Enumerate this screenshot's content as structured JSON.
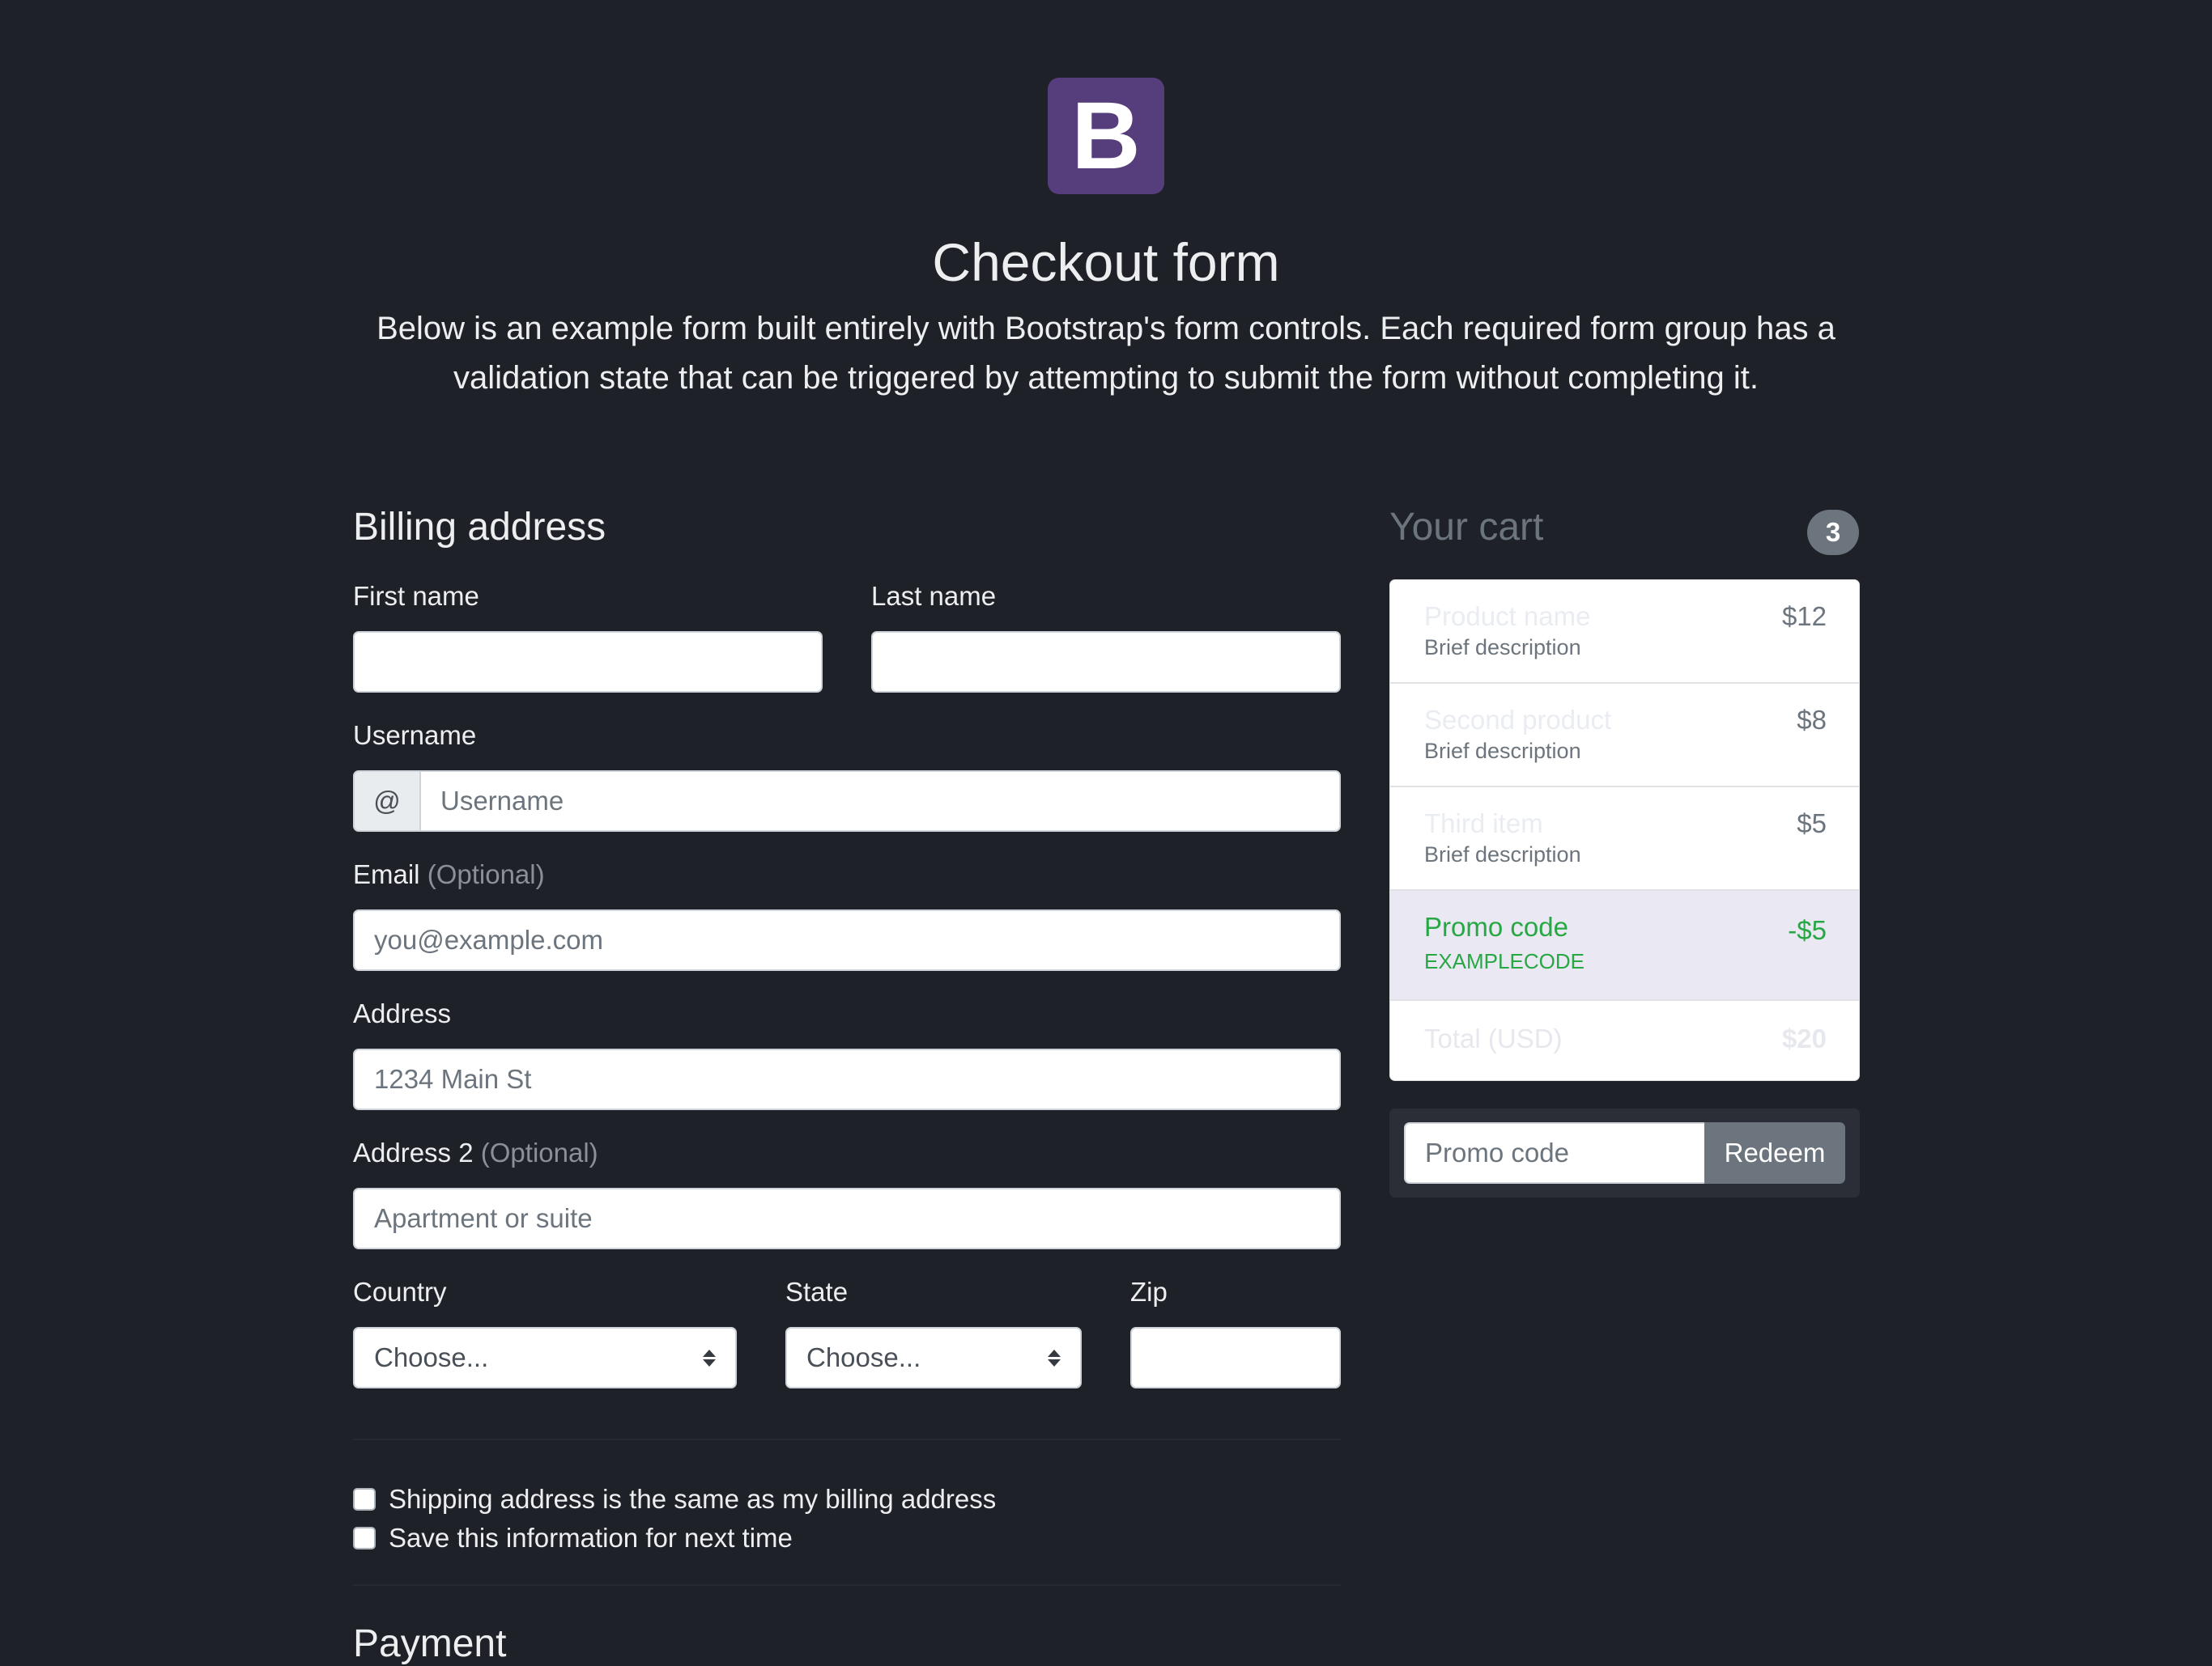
{
  "header": {
    "logo_letter": "B",
    "title": "Checkout form",
    "lead": "Below is an example form built entirely with Bootstrap's form controls. Each required form group has a validation state that can be triggered by attempting to submit the form without completing it."
  },
  "billing": {
    "heading": "Billing address",
    "first_name_label": "First name",
    "first_name_value": "",
    "last_name_label": "Last name",
    "last_name_value": "",
    "username_label": "Username",
    "username_prefix": "@",
    "username_placeholder": "Username",
    "email_label": "Email",
    "email_optional": "(Optional)",
    "email_placeholder": "you@example.com",
    "address_label": "Address",
    "address_placeholder": "1234 Main St",
    "address2_label": "Address 2",
    "address2_optional": "(Optional)",
    "address2_placeholder": "Apartment or suite",
    "country_label": "Country",
    "country_selected": "Choose...",
    "state_label": "State",
    "state_selected": "Choose...",
    "zip_label": "Zip",
    "zip_value": "",
    "same_address_label": "Shipping address is the same as my billing address",
    "save_info_label": "Save this information for next time"
  },
  "payment": {
    "heading": "Payment"
  },
  "cart": {
    "title": "Your cart",
    "count": "3",
    "items": [
      {
        "name": "Product name",
        "description": "Brief description",
        "price": "$12"
      },
      {
        "name": "Second product",
        "description": "Brief description",
        "price": "$8"
      },
      {
        "name": "Third item",
        "description": "Brief description",
        "price": "$5"
      }
    ],
    "promo": {
      "name": "Promo code",
      "code": "EXAMPLECODE",
      "amount": "-$5"
    },
    "total": {
      "label": "Total (USD)",
      "amount": "$20"
    },
    "promo_input_placeholder": "Promo code",
    "redeem_label": "Redeem"
  },
  "colors": {
    "background": "#1f2128",
    "brand": "#563d7c",
    "success": "#28a745",
    "secondary": "#6c757d"
  }
}
